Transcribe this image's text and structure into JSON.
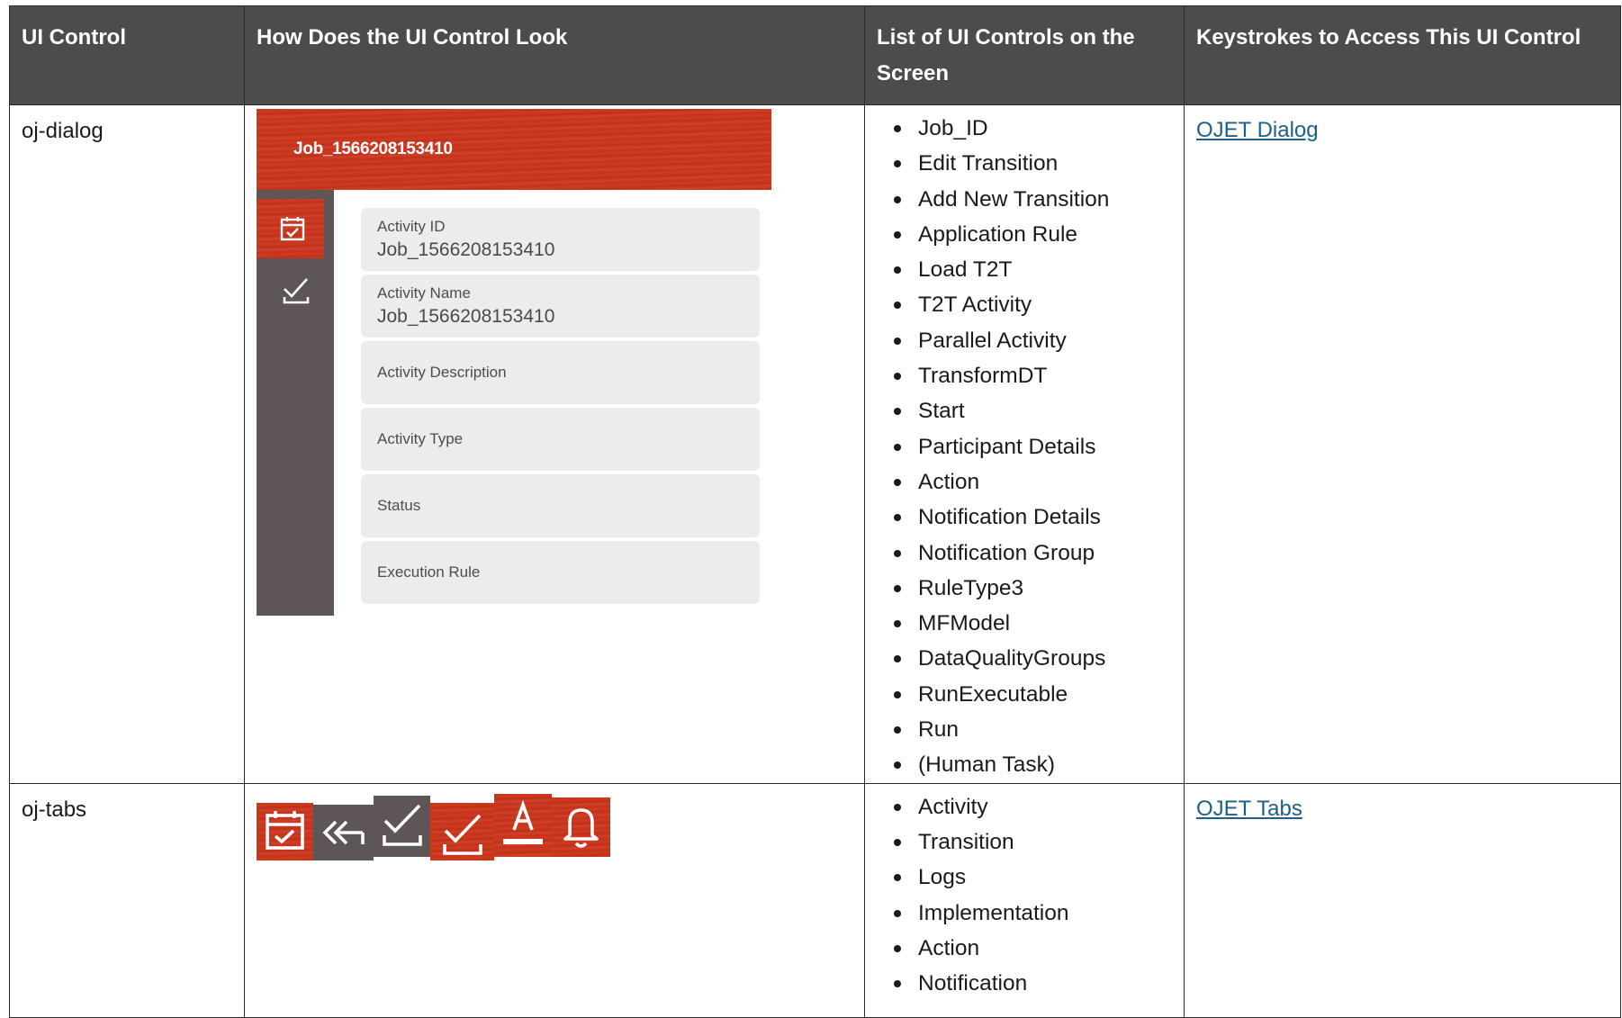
{
  "table": {
    "headers": [
      "UI Control",
      "How Does the UI Control Look",
      "List of UI Controls on the Screen",
      "Keystrokes to Access This UI Control"
    ],
    "rows": [
      {
        "control": "oj-dialog",
        "preview": {
          "title": "Job_1566208153410",
          "side_icons": [
            "calendar-check-icon",
            "check-underline-icon"
          ],
          "fields": [
            {
              "label": "Activity ID",
              "value": "Job_1566208153410"
            },
            {
              "label": "Activity Name",
              "value": "Job_1566208153410"
            },
            {
              "label": "Activity Description",
              "value": ""
            },
            {
              "label": "Activity Type",
              "value": ""
            },
            {
              "label": "Status",
              "value": ""
            },
            {
              "label": "Execution Rule",
              "value": ""
            }
          ]
        },
        "list": [
          "Job_ID",
          "Edit Transition",
          "Add New Transition",
          "Application Rule",
          "Load T2T",
          "T2T Activity",
          "Parallel Activity",
          "TransformDT",
          "Start",
          "Participant Details",
          "Action",
          "Notification Details",
          "Notification Group",
          "RuleType3",
          "MFModel",
          "DataQualityGroups",
          "RunExecutable",
          "Run",
          "(Human Task)"
        ],
        "keystroke_link": "OJET Dialog"
      },
      {
        "control": "oj-tabs",
        "preview": {
          "tab_icons": [
            "calendar-check-icon",
            "double-back-arrow-icon",
            "check-underline-icon",
            "check-underline-icon",
            "text-underline-icon",
            "bell-icon"
          ]
        },
        "list": [
          "Activity",
          "Transition",
          "Logs",
          "Implementation",
          "Action",
          "Notification"
        ],
        "keystroke_link": "OJET Tabs"
      }
    ]
  },
  "colors": {
    "header_bg": "#4b4c4e",
    "accent_red": "#c3331c",
    "side_grey": "#5e5656",
    "link": "#1f5f86"
  }
}
